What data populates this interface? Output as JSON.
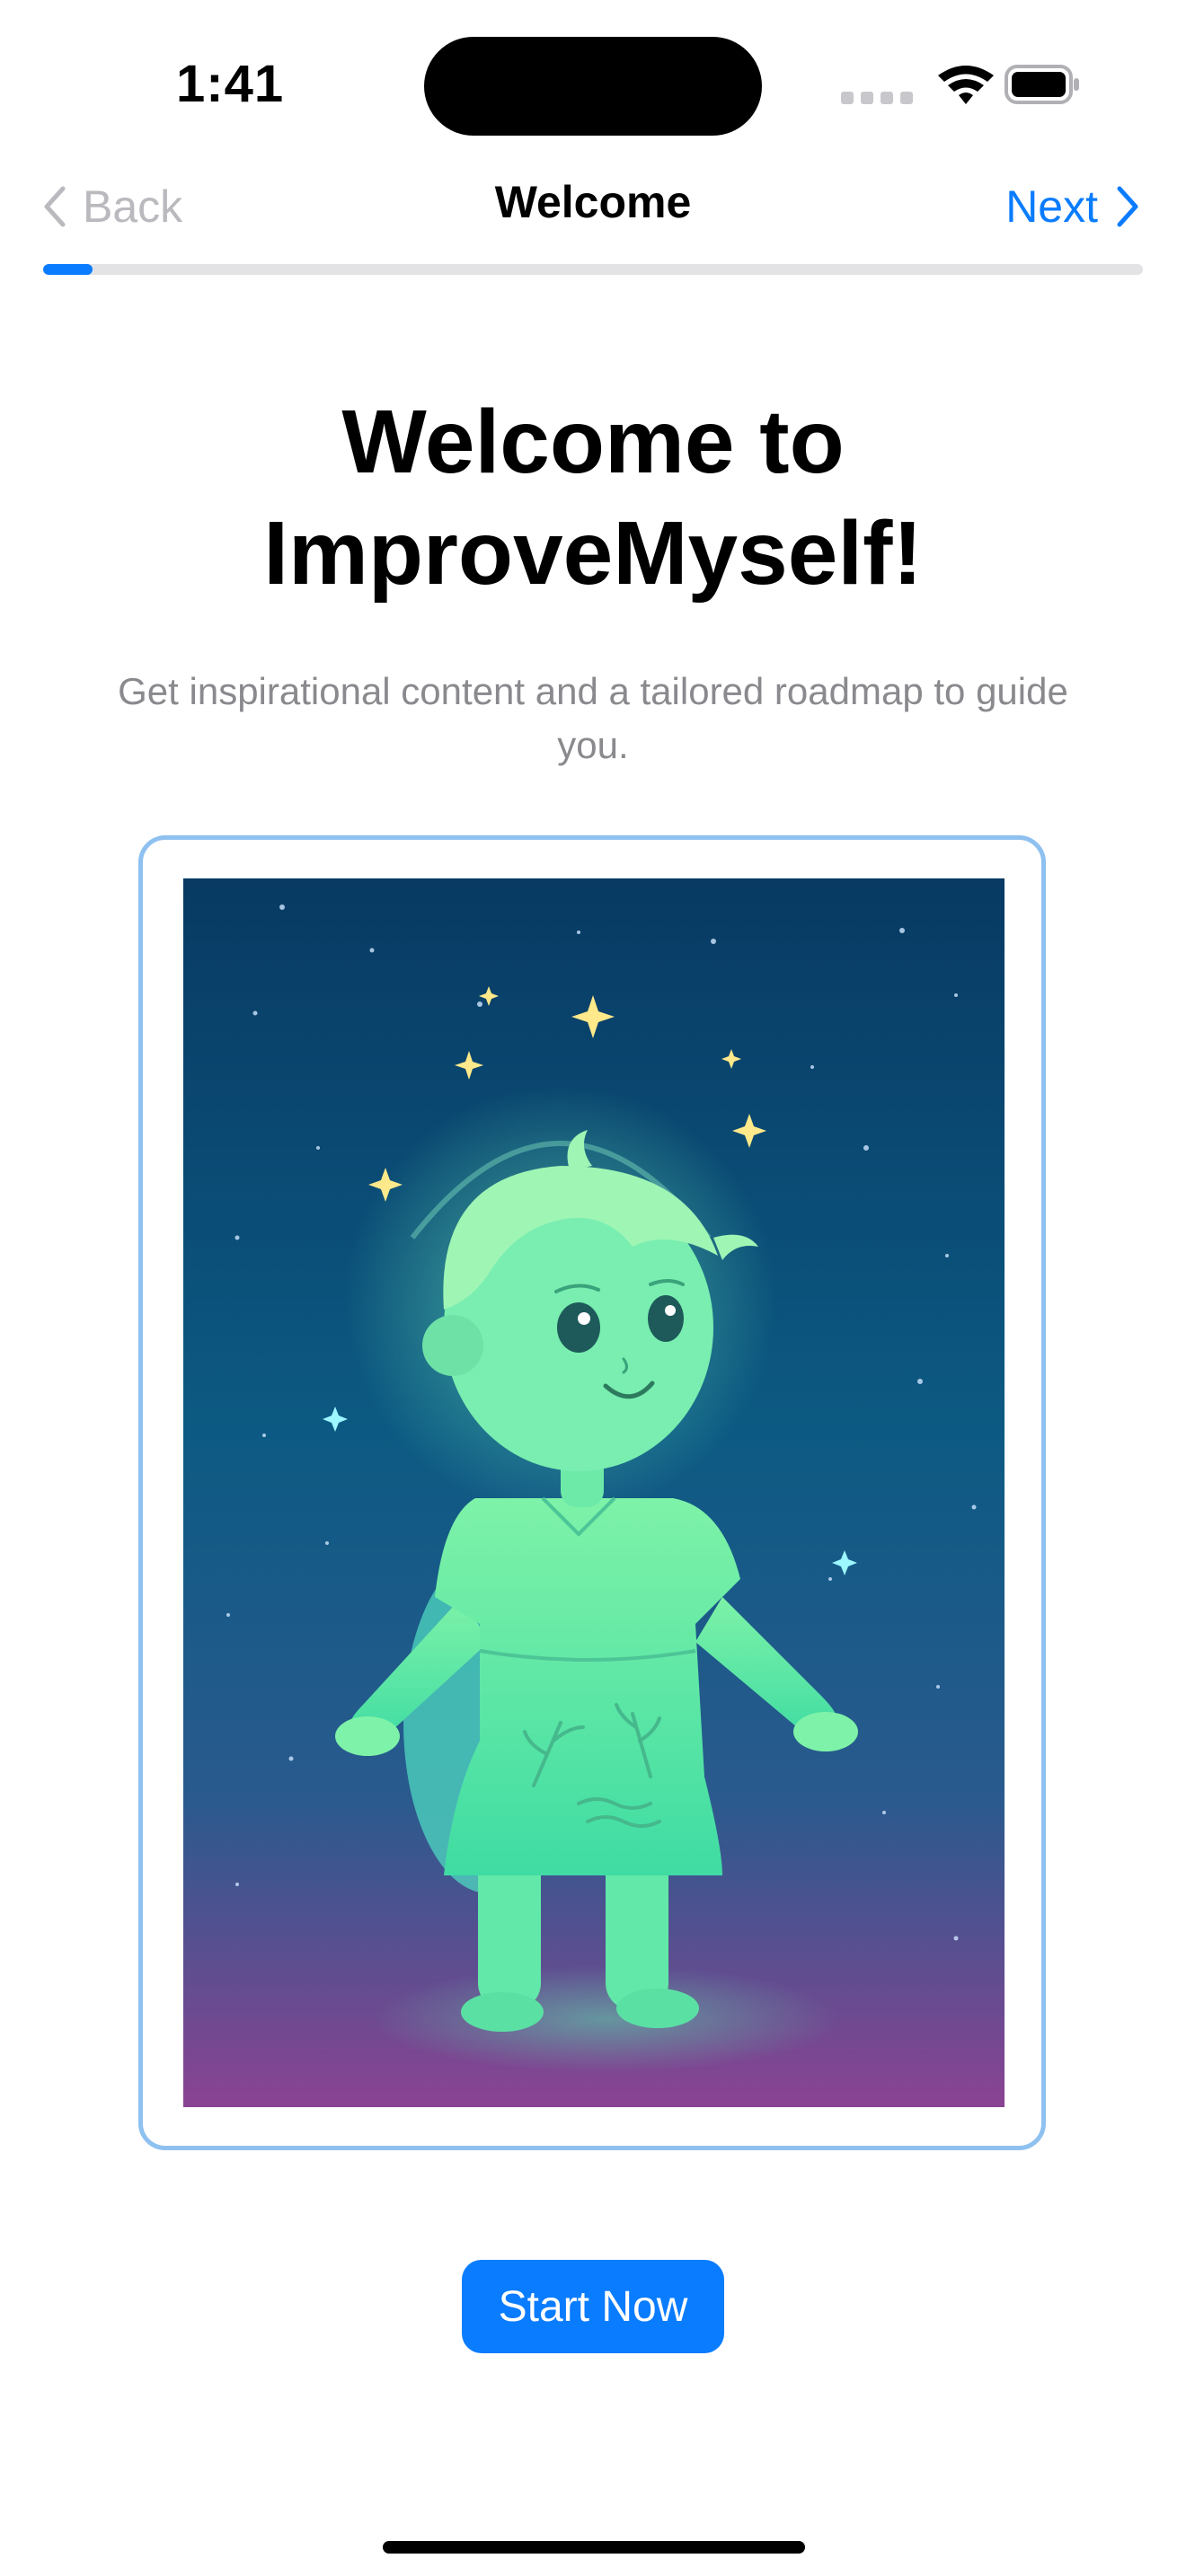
{
  "status_bar": {
    "time": "1:41",
    "icons": [
      "cellular-signal-icon",
      "wifi-icon",
      "battery-icon"
    ]
  },
  "nav": {
    "back_label": "Back",
    "title": "Welcome",
    "next_label": "Next"
  },
  "progress": {
    "fraction": 0.045
  },
  "content": {
    "headline_line1": "Welcome to",
    "headline_line2": "ImproveMyself!",
    "subtitle": "Get inspirational content and a tailored roadmap to guide you."
  },
  "primary_action": {
    "label": "Start Now"
  },
  "colors": {
    "accent": "#0a7cff",
    "frame_border": "#8fc1f0",
    "muted_text": "#8a8a8e",
    "disabled_nav": "#b9b9be"
  }
}
